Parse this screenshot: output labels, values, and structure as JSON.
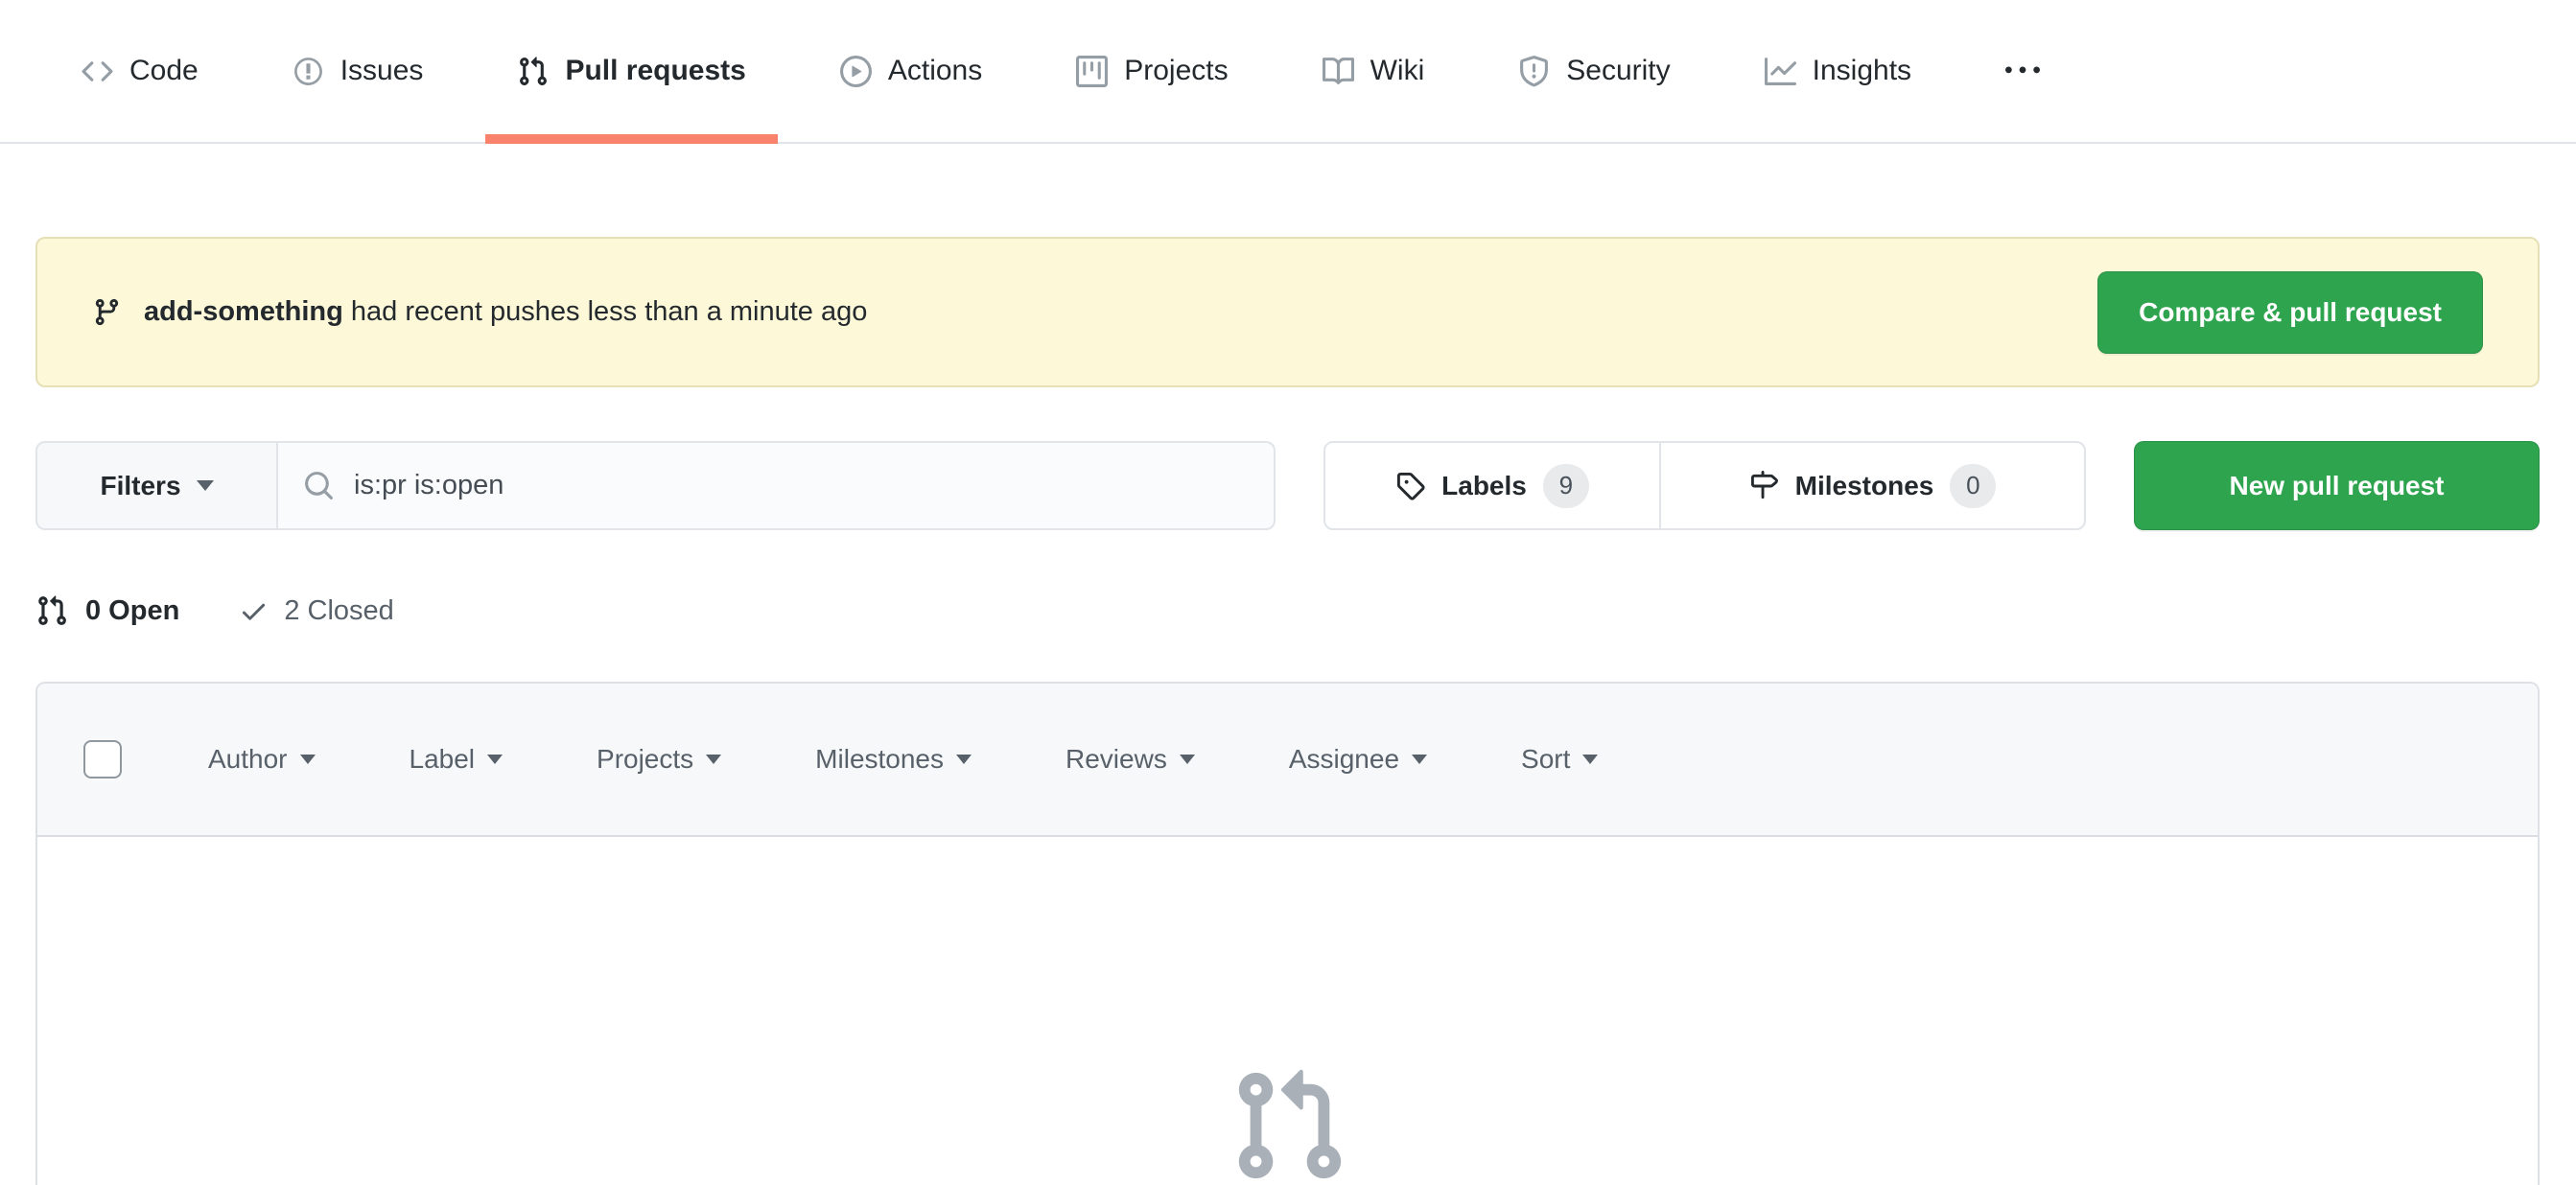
{
  "nav": {
    "tabs": [
      {
        "label": "Code"
      },
      {
        "label": "Issues"
      },
      {
        "label": "Pull requests"
      },
      {
        "label": "Actions"
      },
      {
        "label": "Projects"
      },
      {
        "label": "Wiki"
      },
      {
        "label": "Security"
      },
      {
        "label": "Insights"
      }
    ]
  },
  "banner": {
    "branch_name": "add-something",
    "message": "had recent pushes less than a minute ago",
    "compare_button": "Compare & pull request"
  },
  "toolbar": {
    "filters_label": "Filters",
    "search_value": "is:pr is:open",
    "labels_label": "Labels",
    "labels_count": "9",
    "milestones_label": "Milestones",
    "milestones_count": "0",
    "new_pr_button": "New pull request"
  },
  "states": {
    "open_label": "0 Open",
    "closed_label": "2 Closed"
  },
  "list_header": {
    "columns": [
      "Author",
      "Label",
      "Projects",
      "Milestones",
      "Reviews",
      "Assignee",
      "Sort"
    ]
  },
  "colors": {
    "accent_green": "#2ea44f",
    "active_tab_underline": "#f9826c",
    "banner_background": "#fcf8d8",
    "list_header_background": "#f6f8fa",
    "border": "#e1e4e8",
    "text_primary": "#24292e",
    "text_secondary": "#586069"
  }
}
